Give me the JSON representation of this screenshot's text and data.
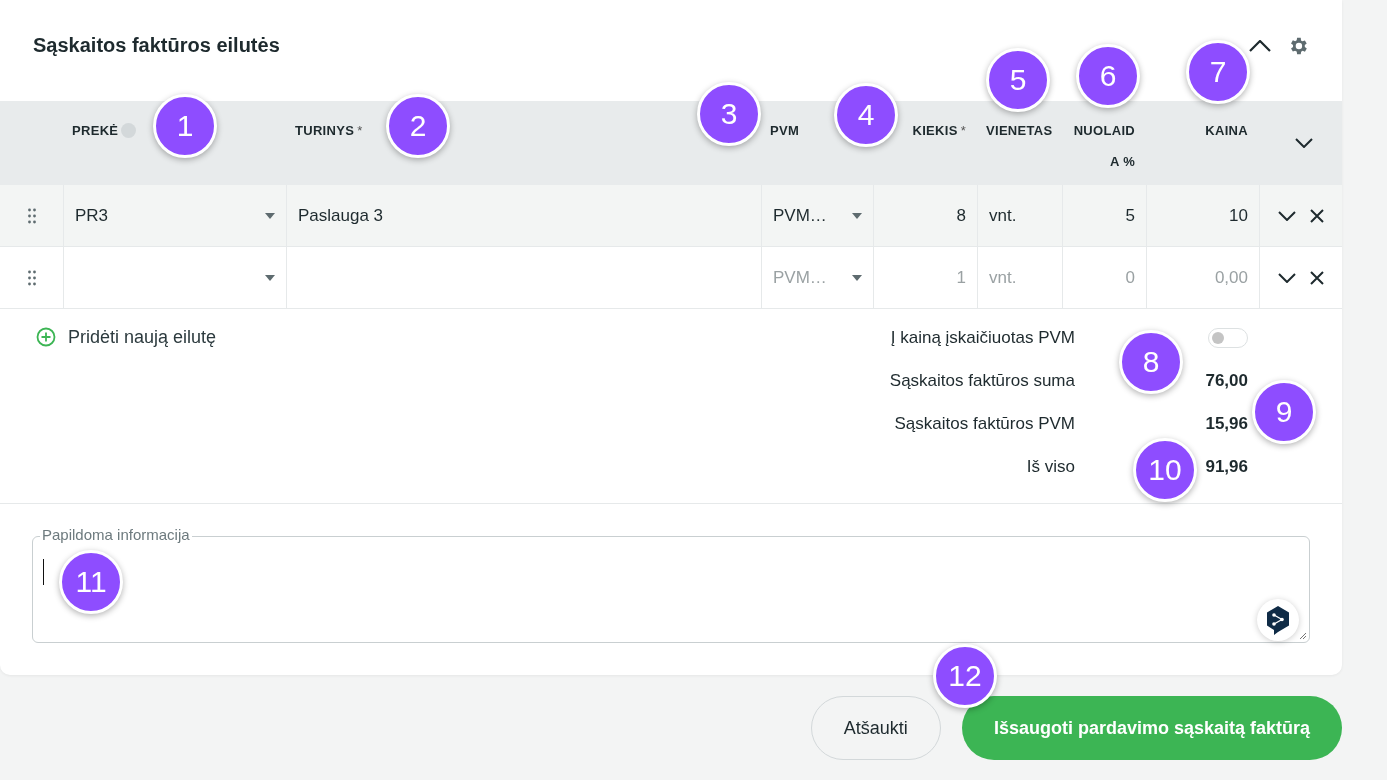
{
  "section": {
    "title": "Sąskaitos faktūros eilutės",
    "expanded": true
  },
  "table": {
    "columns": [
      {
        "label": "PREKĖ",
        "info": true
      },
      {
        "label": "TURINYS",
        "mark": "*"
      },
      {
        "label": "PVM"
      },
      {
        "label": "KIEKIS",
        "mark": "*"
      },
      {
        "label": "VIENETAS"
      },
      {
        "label": "NUOLAIDA %"
      },
      {
        "label": "KAINA"
      }
    ],
    "rows": [
      {
        "highlighted": true,
        "draft": false,
        "cells": [
          "PR3",
          "Paslauga 3",
          "PVM…",
          "8",
          "vnt.",
          "5",
          "10"
        ]
      },
      {
        "highlighted": false,
        "draft": true,
        "cells": [
          null,
          null,
          "PVM…",
          "1",
          "vnt.",
          "0",
          "0,00"
        ]
      }
    ]
  },
  "add_row": {
    "label": "Pridėti naują eilutę"
  },
  "totals": {
    "vat_included": {
      "label": "Į kainą įskaičiuotas PVM",
      "on": false
    },
    "lines": [
      {
        "label": "Sąskaitos faktūros suma",
        "value": "76,00"
      },
      {
        "label": "Sąskaitos faktūros PVM",
        "value": "15,96"
      },
      {
        "label": "Iš viso",
        "value": "91,96"
      }
    ]
  },
  "notes": {
    "label": "Papildoma informacija",
    "focused": true
  },
  "buttons": [
    {
      "label": "Atšaukti",
      "kind": "secondary"
    },
    {
      "label": "Išsaugoti pardavimo sąskaitą faktūrą",
      "kind": "primary"
    }
  ],
  "annotations": [
    {
      "label": "1"
    },
    {
      "label": "2"
    },
    {
      "label": "3"
    },
    {
      "label": "4"
    },
    {
      "label": "5"
    },
    {
      "label": "6"
    },
    {
      "label": "7"
    },
    {
      "label": "8"
    },
    {
      "label": "9"
    },
    {
      "label": "10"
    },
    {
      "label": "11"
    },
    {
      "label": "12"
    }
  ]
}
